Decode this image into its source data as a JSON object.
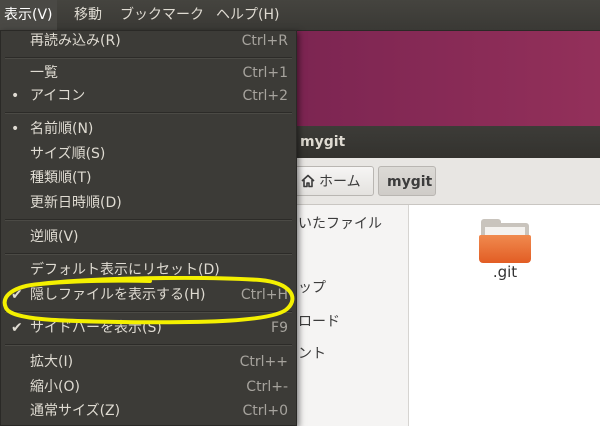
{
  "menubar": {
    "items": [
      "表示(V)",
      "移動",
      "ブックマーク",
      "ヘルプ(H)"
    ]
  },
  "window": {
    "title": "mygit"
  },
  "breadcrumb": {
    "home_label": "ホーム",
    "current_label": "mygit"
  },
  "sidebar": {
    "items": [
      "いたファイル",
      "ップ",
      "ロード",
      "ント"
    ]
  },
  "files": [
    {
      "name": ".git",
      "icon": "folder-icon"
    }
  ],
  "view_menu": {
    "reload": {
      "label": "再読み込み(R)",
      "accel": "Ctrl+R"
    },
    "list": {
      "label": "一覧",
      "accel": "Ctrl+1"
    },
    "icons": {
      "label": "アイコン",
      "accel": "Ctrl+2"
    },
    "by_name": {
      "label": "名前順(N)"
    },
    "by_size": {
      "label": "サイズ順(S)"
    },
    "by_type": {
      "label": "種類順(T)"
    },
    "by_date": {
      "label": "更新日時順(D)"
    },
    "reversed": {
      "label": "逆順(V)"
    },
    "reset_view": {
      "label": "デフォルト表示にリセット(D)"
    },
    "show_hidden": {
      "label": "隠しファイルを表示する(H)",
      "accel": "Ctrl+H",
      "checked": true
    },
    "show_sidebar": {
      "label": "サイドバーを表示(S)",
      "accel": "F9",
      "checked": true
    },
    "zoom_in": {
      "label": "拡大(I)",
      "accel": "Ctrl++"
    },
    "zoom_out": {
      "label": "縮小(O)",
      "accel": "Ctrl+-"
    },
    "normal_size": {
      "label": "通常サイズ(Z)",
      "accel": "Ctrl+0"
    }
  },
  "colors": {
    "menu_bg": "#3c3b37",
    "menu_text": "#dfdbd2",
    "accel_text": "#a6a39d",
    "highlight_circle": "#f4f000",
    "desktop": "#7a2451",
    "folder": "#e8703a"
  }
}
